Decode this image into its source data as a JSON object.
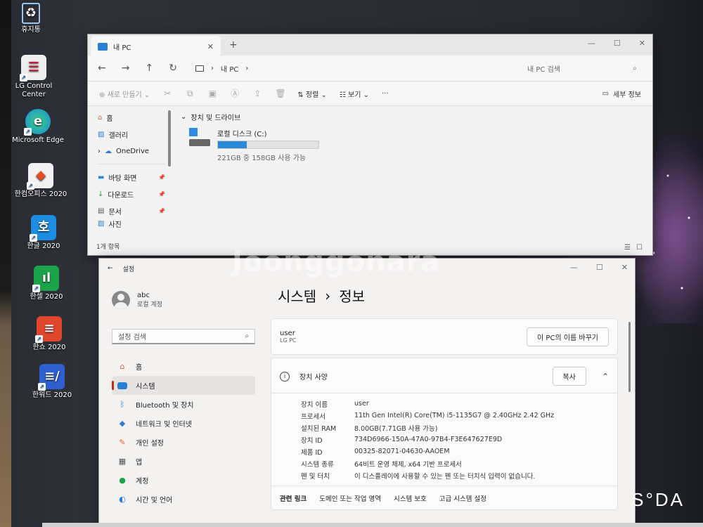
{
  "desktop": {
    "icons": [
      {
        "label": "휴지통",
        "icon": "recycle-bin-icon",
        "color": "#6aa3d8"
      },
      {
        "label": "LG Control Center",
        "icon": "lg-control-center-icon",
        "color": "#c8102e"
      },
      {
        "label": "Microsoft Edge",
        "icon": "edge-icon",
        "color": "#1b8ce3"
      },
      {
        "label": "한컴오피스 2020",
        "icon": "hancom-office-icon",
        "color": "#e44d26"
      },
      {
        "label": "한글 2020",
        "icon": "hangul-icon",
        "color": "#1c8de0"
      },
      {
        "label": "한셀 2020",
        "icon": "hancell-icon",
        "color": "#1aa34a"
      },
      {
        "label": "한쇼 2020",
        "icon": "hanshow-icon",
        "color": "#e0452d"
      },
      {
        "label": "한워드 2020",
        "icon": "hanword-icon",
        "color": "#2f5fd0"
      }
    ],
    "watermark": "Joonggonara",
    "brand_mark": "S°DA"
  },
  "explorer": {
    "tab_title": "내 PC",
    "address": "내 PC",
    "search_placeholder": "내 PC 검색",
    "toolbar": {
      "new": "새로 만들기",
      "sort": "정렬",
      "view": "보기",
      "more": "···",
      "details": "세부 정보"
    },
    "sidebar": [
      {
        "label": "홈",
        "icon": "home-icon"
      },
      {
        "label": "갤러리",
        "icon": "gallery-icon"
      },
      {
        "label": "OneDrive",
        "icon": "onedrive-icon"
      },
      {
        "label": "바탕 화면",
        "icon": "desktop-folder-icon"
      },
      {
        "label": "다운로드",
        "icon": "download-icon"
      },
      {
        "label": "문서",
        "icon": "documents-icon"
      },
      {
        "label": "사진",
        "icon": "pictures-icon"
      }
    ],
    "group_header": "장치 및 드라이브",
    "drive": {
      "name": "로컬 디스크 (C:)",
      "usage_text": "221GB 중 158GB 사용 가능",
      "used_fraction": 0.285
    },
    "status": "1개 항목"
  },
  "settings": {
    "app_title": "설정",
    "profile": {
      "name": "abc",
      "type": "로컬 계정"
    },
    "search_placeholder": "설정 검색",
    "nav": [
      {
        "label": "홈",
        "icon": "home-icon",
        "color": "#d9642b"
      },
      {
        "label": "시스템",
        "icon": "system-icon",
        "color": "#2a7fd4"
      },
      {
        "label": "Bluetooth 및 장치",
        "icon": "bluetooth-icon",
        "color": "#2a7fd4"
      },
      {
        "label": "네트워크 및 인터넷",
        "icon": "network-icon",
        "color": "#2a7fd4"
      },
      {
        "label": "개인 설정",
        "icon": "personalization-icon",
        "color": "#d9642b"
      },
      {
        "label": "앱",
        "icon": "apps-icon",
        "color": "#555555"
      },
      {
        "label": "계정",
        "icon": "accounts-icon",
        "color": "#1aa34a"
      },
      {
        "label": "시간 및 언어",
        "icon": "time-language-icon",
        "color": "#2a7fd4"
      }
    ],
    "breadcrumb": {
      "parent": "시스템",
      "sep": "›",
      "current": "정보"
    },
    "device_card": {
      "user": "user",
      "model": "LG PC",
      "rename_button": "이 PC의 이름 바꾸기"
    },
    "specs": {
      "title": "장치 사양",
      "copy_button": "복사",
      "rows": [
        {
          "k": "장치 이름",
          "v": "user"
        },
        {
          "k": "프로세서",
          "v": "11th Gen Intel(R) Core(TM) i5-1135G7 @ 2.40GHz   2.42 GHz"
        },
        {
          "k": "설치된 RAM",
          "v": "8.00GB(7.71GB 사용 가능)"
        },
        {
          "k": "장치 ID",
          "v": "734D6966-150A-47A0-97B4-F3E647627E9D"
        },
        {
          "k": "제품 ID",
          "v": "00325-82071-04630-AAOEM"
        },
        {
          "k": "시스템 종류",
          "v": "64비트 운영 체제, x64 기반 프로세서"
        },
        {
          "k": "펜 및 터치",
          "v": "이 디스플레이에 사용할 수 있는 펜 또는 터치식 입력이 없습니다."
        }
      ]
    },
    "related_links": [
      "관련 링크",
      "도메인 또는 작업 영역",
      "시스템 보호",
      "고급 시스템 설정"
    ]
  }
}
